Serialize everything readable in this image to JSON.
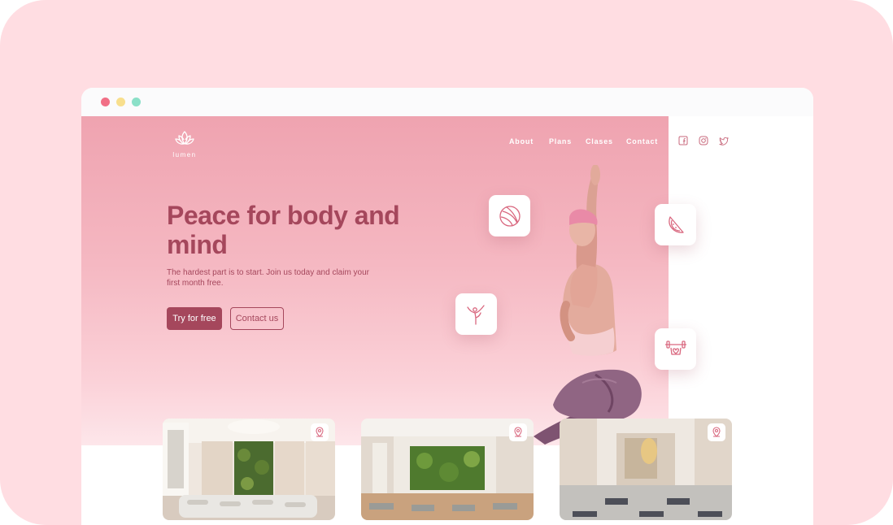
{
  "brand": {
    "name": "lumen"
  },
  "nav": {
    "items": [
      "About",
      "Plans",
      "Clases",
      "Contact"
    ]
  },
  "social": [
    "facebook-icon",
    "instagram-icon",
    "twitter-icon"
  ],
  "hero": {
    "headline": "Peace for body and mind",
    "subtext": "The hardest part is to start. Join us today and claim your first month free.",
    "primary_cta": "Try for free",
    "secondary_cta": "Contact us"
  },
  "feature_icons": [
    "ball-icon",
    "watermelon-icon",
    "yoga-pose-icon",
    "weight-icon"
  ],
  "studios": [
    {
      "name": "studio-1",
      "icon": "location-pin-icon"
    },
    {
      "name": "studio-2",
      "icon": "location-pin-icon"
    },
    {
      "name": "studio-3",
      "icon": "location-pin-icon"
    }
  ],
  "colors": {
    "frame": "#ffdde2",
    "hero_top": "#efa3b0",
    "accent": "#a5475c",
    "white": "#ffffff"
  }
}
